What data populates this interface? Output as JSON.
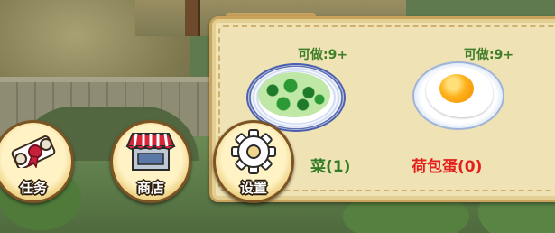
{
  "recipes": [
    {
      "can_make": "可做:9+",
      "name": "菜(1)",
      "name_color": "#2f7d24",
      "icon": "stir-fried-greens-dish"
    },
    {
      "can_make": "可做:9+",
      "name": "荷包蛋(0)",
      "name_color": "#e3211c",
      "icon": "fried-egg-dish"
    }
  ],
  "menu": {
    "task_label": "任务",
    "shop_label": "商店",
    "settings_label": "设置"
  },
  "colors": {
    "can_make_text": "#3f7f2a",
    "panel_bg": "#efe2b4",
    "panel_border": "#c9a25e"
  }
}
